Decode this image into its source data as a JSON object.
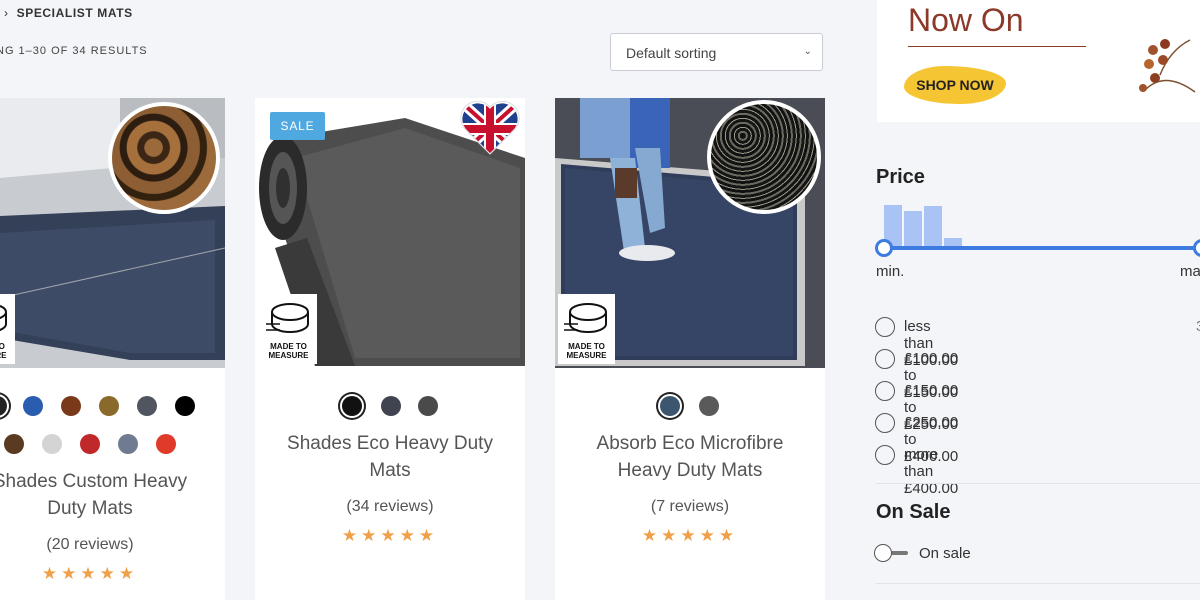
{
  "breadcrumb": {
    "current": "SPECIALIST MATS"
  },
  "results_text": "NG 1–30 OF 34 RESULTS",
  "sorting": {
    "selected": "Default sorting"
  },
  "products": [
    {
      "title_line1": "Shades Custom Heavy",
      "title_line2": "Duty Mats",
      "reviews": "(20 reviews)",
      "rating": 5,
      "made_to_measure": "MADE TO MEASURE",
      "swatch_colors_row1": [
        "#222222",
        "#2a5db0",
        "#7a3a1a",
        "#8a6a2a",
        "#505560",
        "#000000"
      ],
      "swatch_colors_row2": [
        "#5a3a20",
        "#d4d4d4",
        "#c0282a",
        "#6f7b90",
        "#e03a2a"
      ]
    },
    {
      "badge": "SALE",
      "title_line1": "Shades Eco Heavy Duty",
      "title_line2": "Mats",
      "reviews": "(34 reviews)",
      "rating": 5,
      "made_to_measure_line1": "MADE TO",
      "made_to_measure_line2": "MEASURE",
      "swatch_colors": [
        "#111111",
        "#3f4450",
        "#4a4a4a"
      ]
    },
    {
      "title_line1": "Absorb Eco Microfibre",
      "title_line2": "Heavy Duty Mats",
      "reviews": "(7 reviews)",
      "rating": 5,
      "made_to_measure_line1": "MADE TO",
      "made_to_measure_line2": "MEASURE",
      "swatch_colors": [
        "#3e5570",
        "#5a5a5a"
      ]
    }
  ],
  "banner": {
    "headline": "Now On",
    "cta": "SHOP NOW"
  },
  "price_filter": {
    "title": "Price",
    "min_label": "min.",
    "max_label": "ma",
    "histogram": [
      0.9,
      0.78,
      0.88,
      0.2,
      0.04,
      0.03,
      0.03,
      0.02,
      0.02,
      0.02,
      0.02,
      0.02,
      0.02,
      0.02,
      0.02
    ],
    "ranges": [
      "less than £100.00",
      "£100.00 to £150.00",
      "£150.00 to £250.00",
      "£250.00 to £400.00",
      "more than £400.00"
    ],
    "right_count_partial": "3"
  },
  "on_sale_filter": {
    "title": "On Sale",
    "toggle_label": "On sale"
  },
  "colors": {
    "accent": "#3d7be0",
    "star": "#f0a048",
    "sale_badge": "#4fa8e0",
    "histogram": "#a9c3f5"
  }
}
